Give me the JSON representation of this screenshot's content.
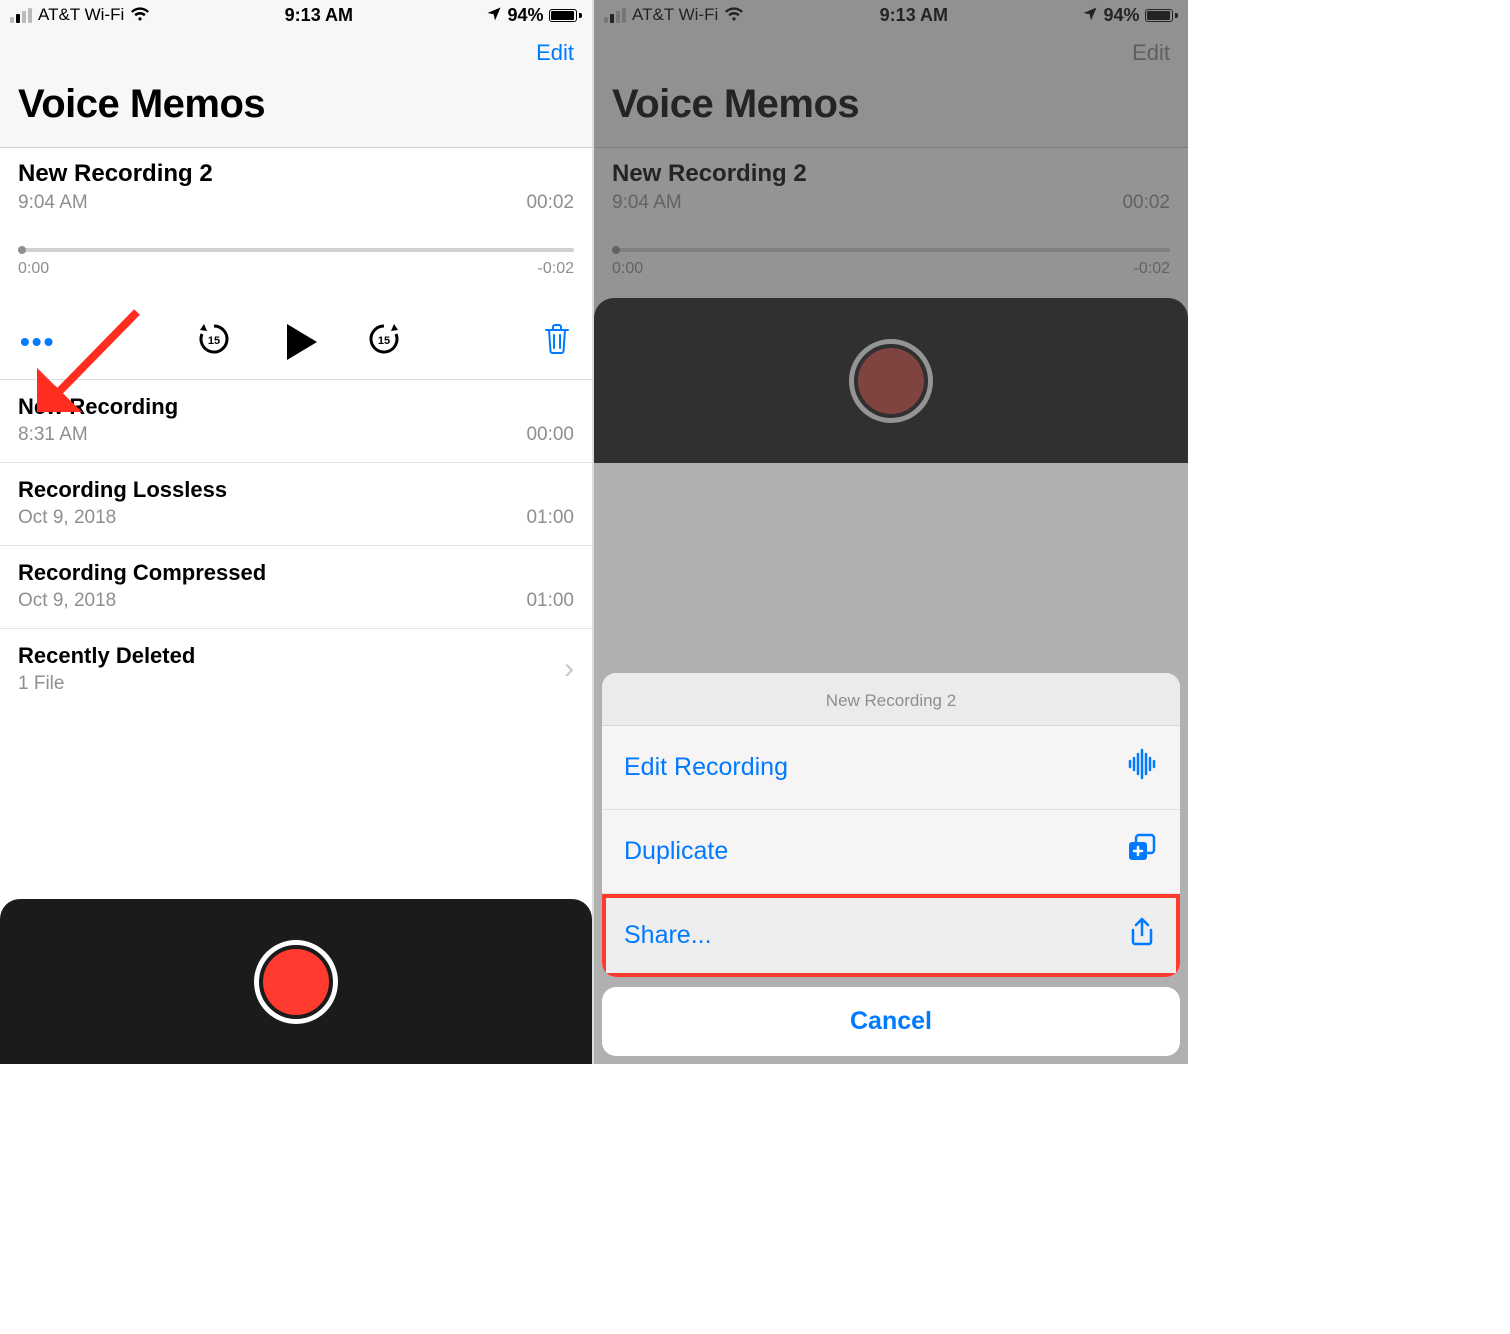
{
  "status": {
    "carrier": "AT&T Wi-Fi",
    "time": "9:13 AM",
    "battery_pct": "94%"
  },
  "header": {
    "edit": "Edit",
    "title": "Voice Memos"
  },
  "expanded": {
    "title": "New Recording 2",
    "subtime": "9:04 AM",
    "duration": "00:02",
    "scrub_start": "0:00",
    "scrub_end": "-0:02"
  },
  "list": [
    {
      "title": "New Recording",
      "sub": "8:31 AM",
      "dur": "00:00"
    },
    {
      "title": "Recording Lossless",
      "sub": "Oct 9, 2018",
      "dur": "01:00"
    },
    {
      "title": "Recording Compressed",
      "sub": "Oct 9, 2018",
      "dur": "01:00"
    }
  ],
  "recently_deleted": {
    "title": "Recently Deleted",
    "sub": "1 File"
  },
  "sheet": {
    "title": "New Recording 2",
    "edit_recording": "Edit Recording",
    "duplicate": "Duplicate",
    "share": "Share...",
    "cancel": "Cancel"
  }
}
